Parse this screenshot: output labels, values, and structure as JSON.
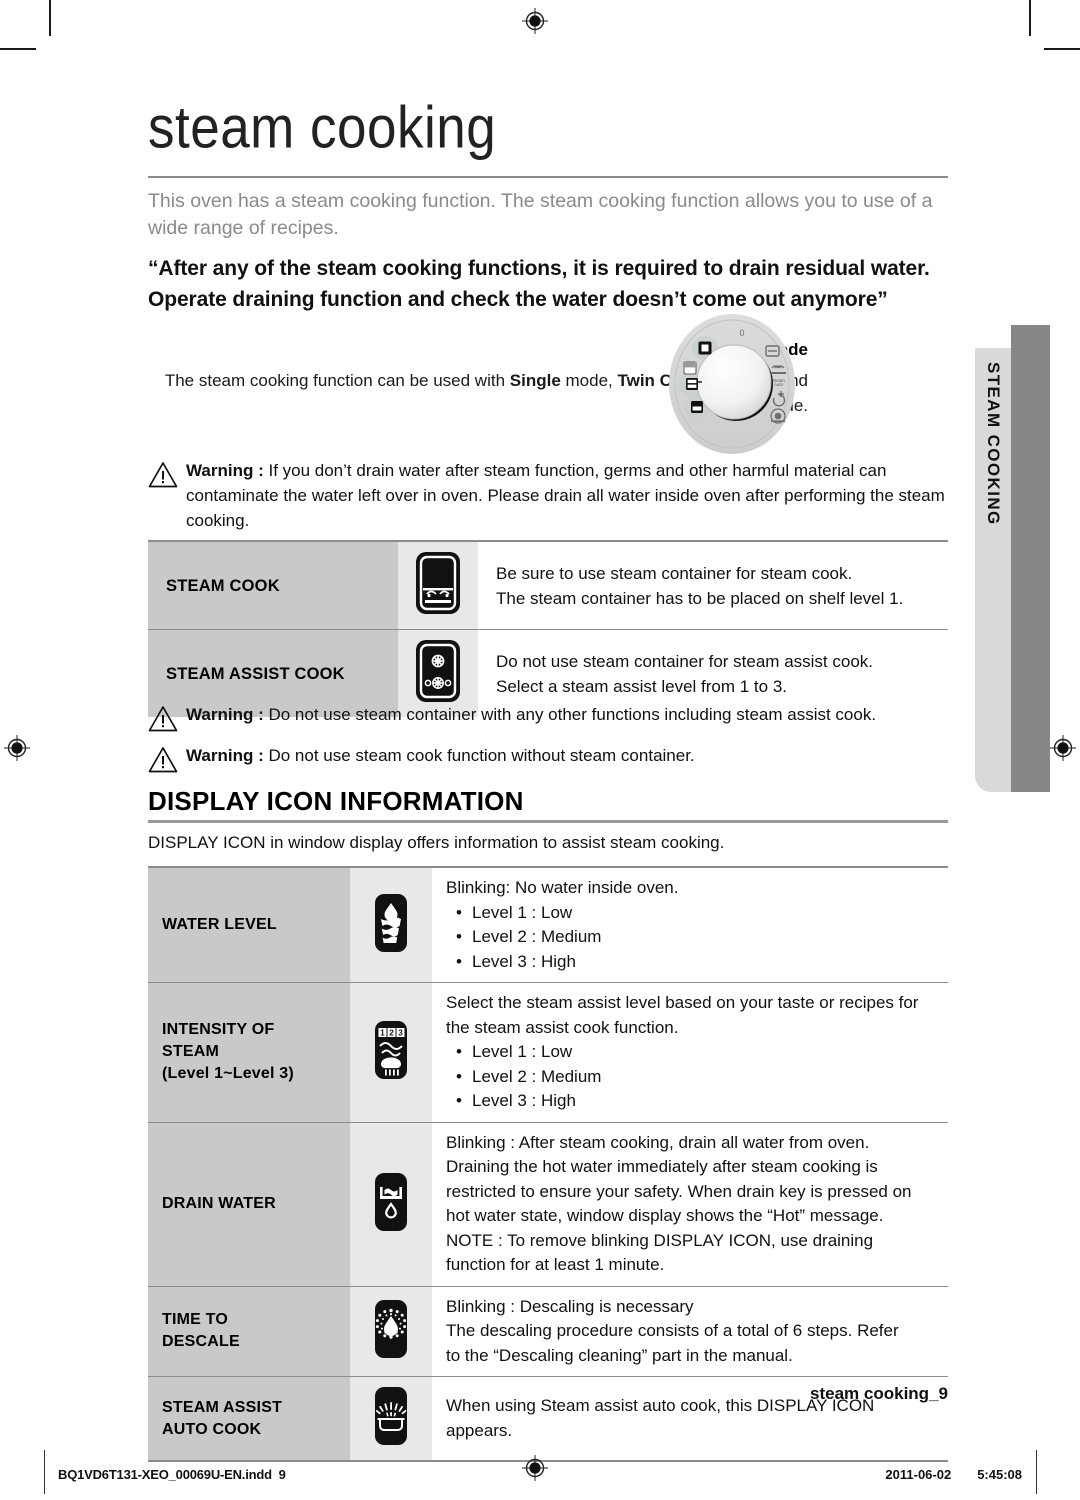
{
  "document": {
    "title": "steam cooking",
    "intro": "This oven has a steam cooking function. The steam cooking function allows you to use of a wide range of recipes.",
    "lead_quote": "“After any of the steam cooking functions, it is required to drain residual water. Operate draining function and check the water doesn’t come out anymore”",
    "side_tab_label": "STEAM COOKING"
  },
  "available_mode": {
    "heading": "Available mode",
    "text_part1": "The steam cooking function can be used with ",
    "bold1": "Single",
    "text_part2": " mode, ",
    "bold2": "Twin Cooking",
    "text_part3": " mode and Lower mode.",
    "dial_zero_label": "0",
    "dial_steam_auto_label": "Steam Auto"
  },
  "warnings": [
    {
      "label": "Warning :",
      "text": " If you don’t drain water after steam function, germs and other harmful material can contaminate the water left over in oven. Please drain all water inside oven after performing the steam cooking."
    },
    {
      "label": "Warning :",
      "text": " Do not use steam container with any other functions including steam assist cook."
    },
    {
      "label": "Warning :",
      "text": " Do not use steam cook function without steam container."
    }
  ],
  "function_table": {
    "rows": [
      {
        "label": "STEAM COOK",
        "icon": "steam-container-oven-icon",
        "lines": [
          "Be sure to use steam container for steam cook.",
          "The steam container has to be placed on shelf level 1."
        ]
      },
      {
        "label": "STEAM ASSIST COOK",
        "icon": "steam-assist-oven-icon",
        "lines": [
          "Do not use steam container for steam assist cook.",
          "Select a steam assist level from 1 to 3."
        ]
      }
    ]
  },
  "display_icon_section": {
    "heading": "DISPLAY ICON INFORMATION",
    "note": "DISPLAY ICON in window display offers information to assist steam cooking.",
    "rows": [
      {
        "label_lines": [
          "WATER LEVEL"
        ],
        "icon": "water-level-icon",
        "lines": [
          "Blinking: No water inside oven."
        ],
        "bullets": [
          "Level 1 : Low",
          "Level 2 : Medium",
          "Level 3 : High"
        ]
      },
      {
        "label_lines": [
          "INTENSITY OF",
          "STEAM",
          "(Level 1~Level 3)"
        ],
        "icon": "intensity-of-steam-icon",
        "lines": [
          "Select the steam assist level based on your taste or recipes for",
          "the steam assist cook function."
        ],
        "bullets": [
          "Level 1 : Low",
          "Level 2 : Medium",
          "Level 3 : High"
        ]
      },
      {
        "label_lines": [
          "DRAIN WATER"
        ],
        "icon": "drain-water-icon",
        "lines": [
          "Blinking : After steam cooking, drain all water from oven.",
          "Draining the hot water immediately after steam cooking is",
          "restricted to ensure your safety. When drain key is pressed on",
          "hot water state, window display shows the “Hot” message.",
          "NOTE : To remove blinking DISPLAY ICON, use draining",
          "function for at least 1 minute."
        ],
        "bullets": []
      },
      {
        "label_lines": [
          "TIME TO",
          "DESCALE"
        ],
        "icon": "time-to-descale-icon",
        "lines": [
          "Blinking : Descaling is necessary",
          "The descaling procedure consists of a total of 6 steps. Refer",
          "to the “Descaling cleaning” part in the manual."
        ],
        "bullets": []
      },
      {
        "label_lines": [
          "STEAM ASSIST",
          "AUTO COOK"
        ],
        "icon": "steam-assist-auto-cook-icon",
        "lines": [
          "When using Steam assist auto cook, this DISPLAY ICON",
          "appears."
        ],
        "bullets": []
      }
    ]
  },
  "footer": {
    "page_label": "steam cooking_",
    "page_number": "9",
    "print_file": "BQ1VD6T131-XEO_00069U-EN.indd",
    "print_page": "9",
    "print_date": "2011-06-02",
    "print_time": "5:45:08"
  },
  "colors": {
    "label_cell": "#c9c9c9",
    "icon_cell": "#e8e8e8",
    "rule": "#8c8c8c",
    "tab_light": "#d9d9d9",
    "tab_dark": "#878787",
    "intro_text": "#8a8a8a"
  }
}
